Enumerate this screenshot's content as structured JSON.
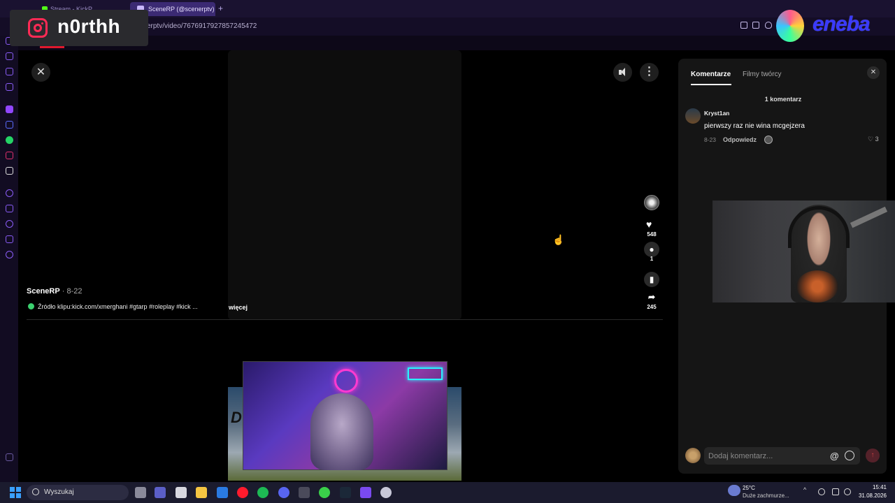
{
  "overlay": {
    "instagram_handle": "n0rthh",
    "brand_name": "eneba"
  },
  "browser": {
    "tabs": [
      {
        "label": "Stream - KickP...",
        "active": false
      },
      {
        "label": "SceneRP (@scenerptv)",
        "active": true
      }
    ],
    "url": "erptv/video/7676917927857245472"
  },
  "video": {
    "author": "SceneRP",
    "date": "8-22",
    "caption": "Źródło klipu:kick.com/xmerghani  #gtarp #roleplay #kick ...",
    "more_label": "więcej",
    "likes": "548",
    "comments": "1",
    "shares": "245",
    "colors": {
      "accent": "#fe2c55"
    }
  },
  "comments_panel": {
    "tabs": [
      "Komentarze",
      "Filmy twórcy"
    ],
    "count_label": "1 komentarz",
    "items": [
      {
        "user": "Kryst1an",
        "text": "pierwszy raz nie wina mcgejzera",
        "date": "8-23",
        "reply_label": "Odpowiedz",
        "likes": "3"
      }
    ],
    "input_placeholder": "Dodaj komentarz..."
  },
  "taskbar": {
    "search_label": "Wyszukaj",
    "weather_temp": "25°C",
    "weather_desc": "Duże zachmurze...",
    "time": "15:41",
    "date": "31.08.2026"
  }
}
